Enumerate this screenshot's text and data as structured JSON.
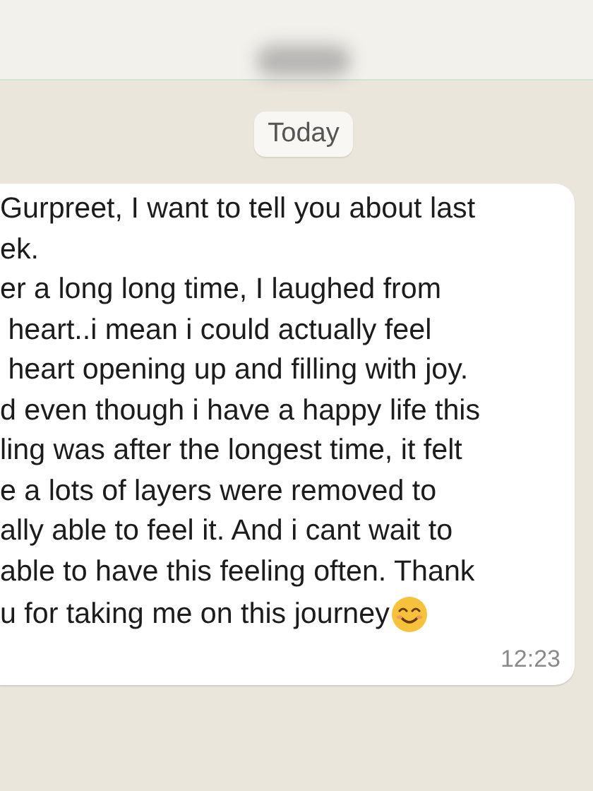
{
  "date_badge": "Today",
  "message": {
    "lines": [
      "Gurpreet, I want to tell you about last",
      "ek.",
      "er a long long time, I laughed from",
      " heart..i mean i could actually feel",
      " heart opening up and filling with joy.",
      "d even though i have a happy life this",
      "ling was after the longest time, it felt",
      "e a lots of layers were removed to",
      "ally able to feel it. And i cant wait to",
      "able to have this feeling often. Thank",
      "u for taking me on this journey"
    ],
    "time": "12:23"
  }
}
